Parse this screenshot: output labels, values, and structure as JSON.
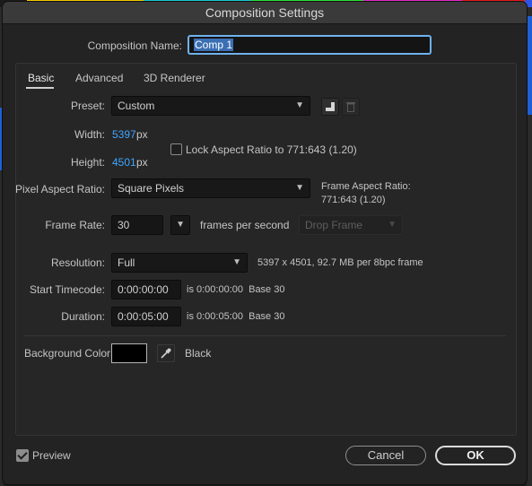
{
  "colors": {
    "top_bars": [
      "#1b1b1b",
      "#f6c900",
      "#19c8d2",
      "#2ee03a",
      "#e42ac9",
      "#e51b1b",
      "#2f55e8",
      "#1b1b1b"
    ],
    "accent_blue": "#3fa6ff",
    "name_field_focus": "#6fb2ee",
    "background_color_swatch": "#000000"
  },
  "window": {
    "title": "Composition Settings"
  },
  "composition_name": {
    "label": "Composition Name:",
    "value_selected": "Comp 1"
  },
  "tabs": [
    {
      "label": "Basic",
      "active": true
    },
    {
      "label": "Advanced",
      "active": false
    },
    {
      "label": "3D Renderer",
      "active": false
    }
  ],
  "preset": {
    "label": "Preset:",
    "value": "Custom",
    "save_icon": "save-preset-icon",
    "delete_icon": "trash-icon"
  },
  "width": {
    "label": "Width:",
    "value": "5397",
    "unit": "px"
  },
  "height": {
    "label": "Height:",
    "value": "4501",
    "unit": "px"
  },
  "lock_aspect": {
    "label": "Lock Aspect Ratio to 771:643 (1.20)",
    "checked": false
  },
  "pixel_aspect": {
    "label": "Pixel Aspect Ratio:",
    "value": "Square Pixels"
  },
  "frame_aspect": {
    "label": "Frame Aspect Ratio:",
    "value": "771:643 (1.20)"
  },
  "frame_rate": {
    "label": "Frame Rate:",
    "value": "30",
    "unit": "frames per second",
    "drop_frame": "Drop Frame"
  },
  "resolution": {
    "label": "Resolution:",
    "value": "Full",
    "info": "5397 x 4501, 92.7 MB per 8bpc frame"
  },
  "start_timecode": {
    "label": "Start Timecode:",
    "value": "0:00:00:00",
    "info": "is 0:00:00:00  Base 30"
  },
  "duration": {
    "label": "Duration:",
    "value": "0:00:05:00",
    "info": "is 0:00:05:00  Base 30"
  },
  "background": {
    "label": "Background Color:",
    "color_name": "Black",
    "eyedropper_icon": "eyedropper-icon"
  },
  "footer": {
    "preview_label": "Preview",
    "preview_checked": true,
    "cancel_label": "Cancel",
    "ok_label": "OK"
  }
}
